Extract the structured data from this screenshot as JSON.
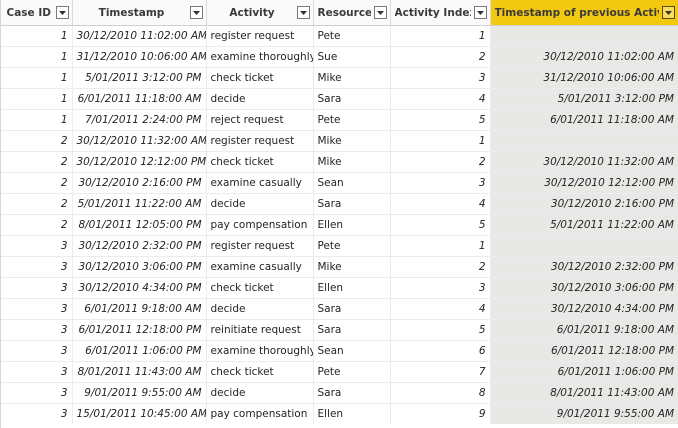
{
  "columns": [
    "Case ID",
    "Timestamp",
    "Activity",
    "Resource",
    "Activity Index",
    "Timestamp of previous Activity"
  ],
  "rows": [
    {
      "case_id": "1",
      "timestamp": "30/12/2010 11:02:00 AM",
      "activity": "register request",
      "resource": "Pete",
      "index": "1",
      "prev": ""
    },
    {
      "case_id": "1",
      "timestamp": "31/12/2010 10:06:00 AM",
      "activity": "examine thoroughly",
      "resource": "Sue",
      "index": "2",
      "prev": "30/12/2010 11:02:00 AM"
    },
    {
      "case_id": "1",
      "timestamp": "5/01/2011 3:12:00 PM",
      "activity": "check ticket",
      "resource": "Mike",
      "index": "3",
      "prev": "31/12/2010 10:06:00 AM"
    },
    {
      "case_id": "1",
      "timestamp": "6/01/2011 11:18:00 AM",
      "activity": "decide",
      "resource": "Sara",
      "index": "4",
      "prev": "5/01/2011 3:12:00 PM"
    },
    {
      "case_id": "1",
      "timestamp": "7/01/2011 2:24:00 PM",
      "activity": "reject request",
      "resource": "Pete",
      "index": "5",
      "prev": "6/01/2011 11:18:00 AM"
    },
    {
      "case_id": "2",
      "timestamp": "30/12/2010 11:32:00 AM",
      "activity": "register request",
      "resource": "Mike",
      "index": "1",
      "prev": ""
    },
    {
      "case_id": "2",
      "timestamp": "30/12/2010 12:12:00 PM",
      "activity": "check ticket",
      "resource": "Mike",
      "index": "2",
      "prev": "30/12/2010 11:32:00 AM"
    },
    {
      "case_id": "2",
      "timestamp": "30/12/2010 2:16:00 PM",
      "activity": "examine casually",
      "resource": "Sean",
      "index": "3",
      "prev": "30/12/2010 12:12:00 PM"
    },
    {
      "case_id": "2",
      "timestamp": "5/01/2011 11:22:00 AM",
      "activity": "decide",
      "resource": "Sara",
      "index": "4",
      "prev": "30/12/2010 2:16:00 PM"
    },
    {
      "case_id": "2",
      "timestamp": "8/01/2011 12:05:00 PM",
      "activity": "pay compensation",
      "resource": "Ellen",
      "index": "5",
      "prev": "5/01/2011 11:22:00 AM"
    },
    {
      "case_id": "3",
      "timestamp": "30/12/2010 2:32:00 PM",
      "activity": "register request",
      "resource": "Pete",
      "index": "1",
      "prev": ""
    },
    {
      "case_id": "3",
      "timestamp": "30/12/2010 3:06:00 PM",
      "activity": "examine casually",
      "resource": "Mike",
      "index": "2",
      "prev": "30/12/2010 2:32:00 PM"
    },
    {
      "case_id": "3",
      "timestamp": "30/12/2010 4:34:00 PM",
      "activity": "check ticket",
      "resource": "Ellen",
      "index": "3",
      "prev": "30/12/2010 3:06:00 PM"
    },
    {
      "case_id": "3",
      "timestamp": "6/01/2011 9:18:00 AM",
      "activity": "decide",
      "resource": "Sara",
      "index": "4",
      "prev": "30/12/2010 4:34:00 PM"
    },
    {
      "case_id": "3",
      "timestamp": "6/01/2011 12:18:00 PM",
      "activity": "reinitiate request",
      "resource": "Sara",
      "index": "5",
      "prev": "6/01/2011 9:18:00 AM"
    },
    {
      "case_id": "3",
      "timestamp": "6/01/2011 1:06:00 PM",
      "activity": "examine thoroughly",
      "resource": "Sean",
      "index": "6",
      "prev": "6/01/2011 12:18:00 PM"
    },
    {
      "case_id": "3",
      "timestamp": "8/01/2011 11:43:00 AM",
      "activity": "check ticket",
      "resource": "Pete",
      "index": "7",
      "prev": "6/01/2011 1:06:00 PM"
    },
    {
      "case_id": "3",
      "timestamp": "9/01/2011 9:55:00 AM",
      "activity": "decide",
      "resource": "Sara",
      "index": "8",
      "prev": "8/01/2011 11:43:00 AM"
    },
    {
      "case_id": "3",
      "timestamp": "15/01/2011 10:45:00 AM",
      "activity": "pay compensation",
      "resource": "Ellen",
      "index": "9",
      "prev": "9/01/2011 9:55:00 AM"
    }
  ],
  "selected_column": "Timestamp of previous Activity",
  "icons": {
    "filter": "chevron-down-icon"
  },
  "colors": {
    "selected_header": "#f2c811",
    "selected_column_fill": "#e8e8e6"
  }
}
